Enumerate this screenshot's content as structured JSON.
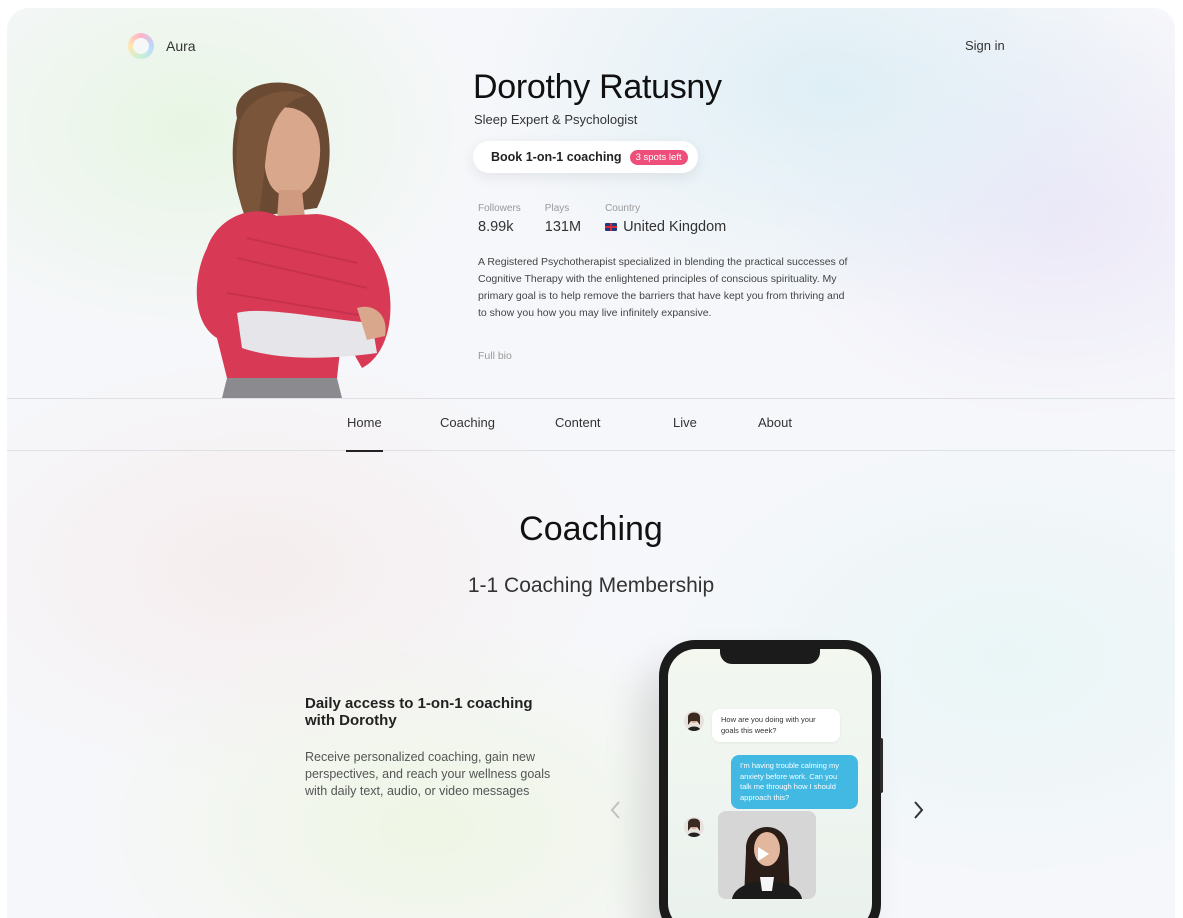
{
  "header": {
    "logo_text": "Aura",
    "sign_in": "Sign in"
  },
  "profile": {
    "name": "Dorothy Ratusny",
    "role": "Sleep Expert & Psychologist",
    "book_button": "Book 1-on-1 coaching",
    "spots_badge": "3 spots left",
    "stats": [
      {
        "label": "Followers",
        "value": "8.99k"
      },
      {
        "label": "Plays",
        "value": "131M"
      },
      {
        "label": "Country",
        "value": "United Kingdom"
      }
    ],
    "bio": "A Registered Psychotherapist specialized in blending the practical successes of Cognitive Therapy with the enlightened principles of conscious spirituality. My primary goal is to help remove the barriers that have kept you from thriving and to show you how you may live infinitely expansive.",
    "full_bio": "Full bio"
  },
  "nav": {
    "tabs": [
      {
        "label": "Home",
        "active": true
      },
      {
        "label": "Coaching"
      },
      {
        "label": "Content"
      },
      {
        "label": "Live"
      },
      {
        "label": "About"
      }
    ]
  },
  "coaching": {
    "title": "Coaching",
    "subtitle": "1-1 Coaching Membership",
    "feature_title": "Daily access to 1-on-1 coaching with Dorothy",
    "feature_desc": "Receive personalized coaching, gain new perspectives, and reach your wellness goals with daily text, audio, or video messages",
    "chat": {
      "msg1": "How are you doing with your goals this week?",
      "msg2": "I'm having trouble calming my anxiety before work. Can you talk me through how I should approach this?"
    }
  },
  "colors": {
    "accent": "#ee4f7a",
    "chat_out": "#41b9e3"
  }
}
